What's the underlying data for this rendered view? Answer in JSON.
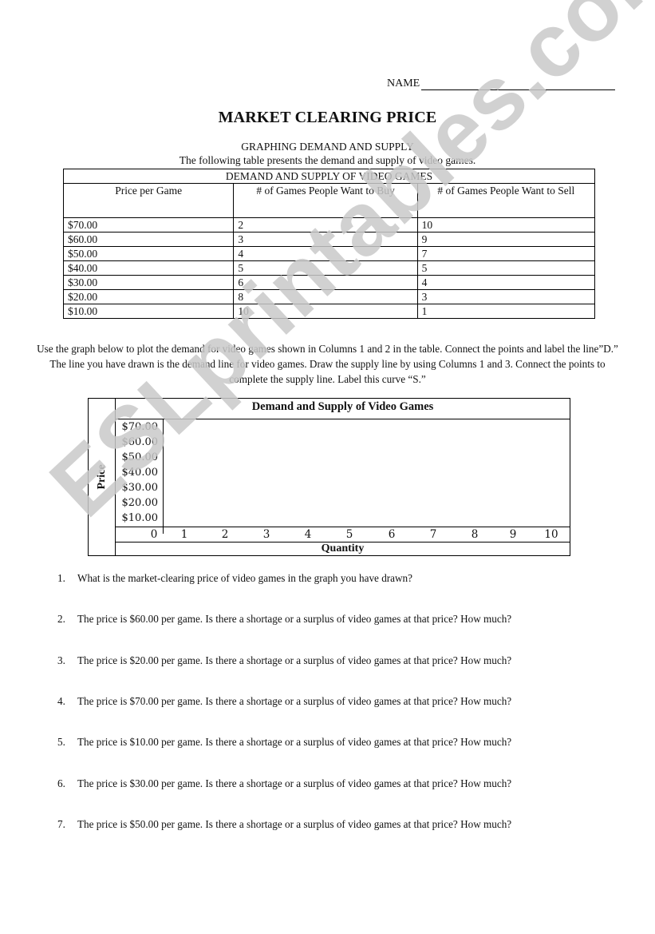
{
  "header": {
    "name_label": "NAME"
  },
  "title": "MARKET CLEARING PRICE",
  "subtitle": "GRAPHING DEMAND AND SUPPLY",
  "intro": "The following table presents the demand and supply of video games.",
  "table": {
    "caption": "DEMAND AND SUPPLY OF VIDEO GAMES",
    "headers": [
      "Price per Game",
      "# of Games People Want to Buy",
      "# of Games People Want to Sell"
    ],
    "rows": [
      [
        "$70.00",
        "2",
        "10"
      ],
      [
        "$60.00",
        "3",
        "9"
      ],
      [
        "$50.00",
        "4",
        "7"
      ],
      [
        "$40.00",
        "5",
        "5"
      ],
      [
        "$30.00",
        "6",
        "4"
      ],
      [
        "$20.00",
        "8",
        "3"
      ],
      [
        "$10.00",
        "10",
        "1"
      ]
    ]
  },
  "instructions": "Use the graph below to plot the demand for video games shown in Columns 1 and 2 in the table.  Connect the points and label the line”D.” The line you have drawn is the demand line for video games.  Draw the supply line by using Columns 1 and 3. Connect the points to complete the supply line. Label this curve “S.”",
  "graph": {
    "title": "Demand and Supply of Video Games",
    "ylabel": "Price",
    "xlabel": "Quantity",
    "yticks": [
      "$70.00",
      "$60.00",
      "$50.00",
      "$40.00",
      "$30.00",
      "$20.00",
      "$10.00"
    ],
    "xticks": [
      "0",
      "1",
      "2",
      "3",
      "4",
      "5",
      "6",
      "7",
      "8",
      "9",
      "10"
    ]
  },
  "questions": [
    {
      "num": "1.",
      "text": "What is the market-clearing price of video games in the graph you have drawn?"
    },
    {
      "num": "2.",
      "text": "The price is $60.00 per game.  Is there a shortage or a surplus of video games at that price?  How much?"
    },
    {
      "num": "3.",
      "text": "The price is $20.00 per game.  Is there a shortage or a surplus of video games at that price? How much?"
    },
    {
      "num": "4.",
      "text": "The price is $70.00 per game.  Is there a shortage or a surplus of video games at that price? How much?"
    },
    {
      "num": "5.",
      "text": "The price is $10.00 per game.  Is there a shortage or a surplus of video games at that price? How much?"
    },
    {
      "num": "6.",
      "text": "The price is $30.00 per game.  Is there a shortage or a surplus of video games at that price? How much?"
    },
    {
      "num": "7.",
      "text": "The price is $50.00 per game.  Is there a shortage or a surplus of video games at that price? How much?"
    }
  ],
  "watermark": "ESLprintables.com"
}
